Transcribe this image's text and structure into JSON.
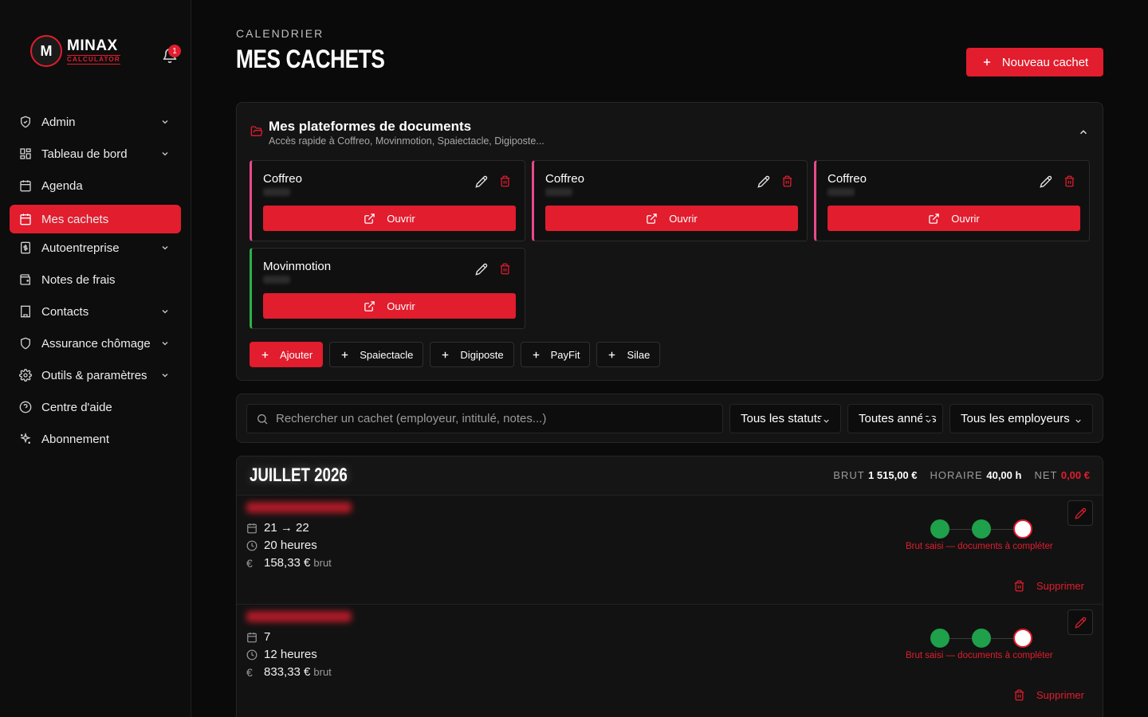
{
  "app": {
    "logo_mark": "M",
    "logo_name": "MINAX",
    "logo_tagline": "CALCULATOR",
    "notifications_count": "1"
  },
  "sidebar": {
    "items": [
      {
        "label": "Admin",
        "icon": "shield-icon",
        "expandable": true
      },
      {
        "label": "Tableau de bord",
        "icon": "dashboard-icon",
        "expandable": true
      },
      {
        "label": "Agenda",
        "icon": "calendar-grid-icon",
        "expandable": false
      },
      {
        "label": "Mes cachets",
        "icon": "calendar-icon",
        "expandable": false,
        "active": true
      },
      {
        "label": "Autoentreprise",
        "icon": "dollar-doc-icon",
        "expandable": true
      },
      {
        "label": "Notes de frais",
        "icon": "wallet-icon",
        "expandable": false
      },
      {
        "label": "Contacts",
        "icon": "building-icon",
        "expandable": true
      },
      {
        "label": "Assurance chômage",
        "icon": "shield-check-icon",
        "expandable": true
      },
      {
        "label": "Outils & paramètres",
        "icon": "gear-icon",
        "expandable": true
      },
      {
        "label": "Centre d'aide",
        "icon": "help-circle-icon",
        "expandable": false
      },
      {
        "label": "Abonnement",
        "icon": "sparkles-icon",
        "expandable": false
      }
    ]
  },
  "header": {
    "eyebrow": "CALENDRIER",
    "title": "MES CACHETS",
    "new_button": "Nouveau cachet"
  },
  "platforms": {
    "title": "Mes plateformes de documents",
    "subtitle": "Accès rapide à Coffreo, Movinmotion, Spaiectacle, Digiposte...",
    "open_label": "Ouvrir",
    "cards": [
      {
        "name": "Coffreo",
        "accent": "#e84a8a"
      },
      {
        "name": "Coffreo",
        "accent": "#e84a8a"
      },
      {
        "name": "Coffreo",
        "accent": "#e84a8a"
      },
      {
        "name": "Movinmotion",
        "accent": "#2bb04a"
      }
    ],
    "add_label": "Ajouter",
    "quick_add": [
      "Spaiectacle",
      "Digiposte",
      "PayFit",
      "Silae"
    ]
  },
  "filters": {
    "search_placeholder": "Rechercher un cachet (employeur, intitulé, notes...)",
    "status": "Tous les statuts",
    "year": "Toutes années",
    "employer": "Tous les employeurs"
  },
  "month": {
    "title": "JUILLET 2026",
    "brut_label": "BRUT",
    "brut_value": "1 515,00 €",
    "horaire_label": "HORAIRE",
    "horaire_value": "40,00 h",
    "net_label": "NET",
    "net_value": "0,00 €",
    "entries": [
      {
        "dates": "21 → 22",
        "hours": "20 heures",
        "amount": "158,33 €",
        "amount_unit": "brut",
        "status": "Brut saisi — documents à compléter",
        "delete_label": "Supprimer"
      },
      {
        "dates": "7",
        "hours": "12 heures",
        "amount": "833,33 €",
        "amount_unit": "brut",
        "status": "Brut saisi — documents à compléter",
        "delete_label": "Supprimer"
      }
    ]
  },
  "colors": {
    "accent": "#e11d2e",
    "success": "#1fa04a",
    "background": "#0a0a0a"
  }
}
